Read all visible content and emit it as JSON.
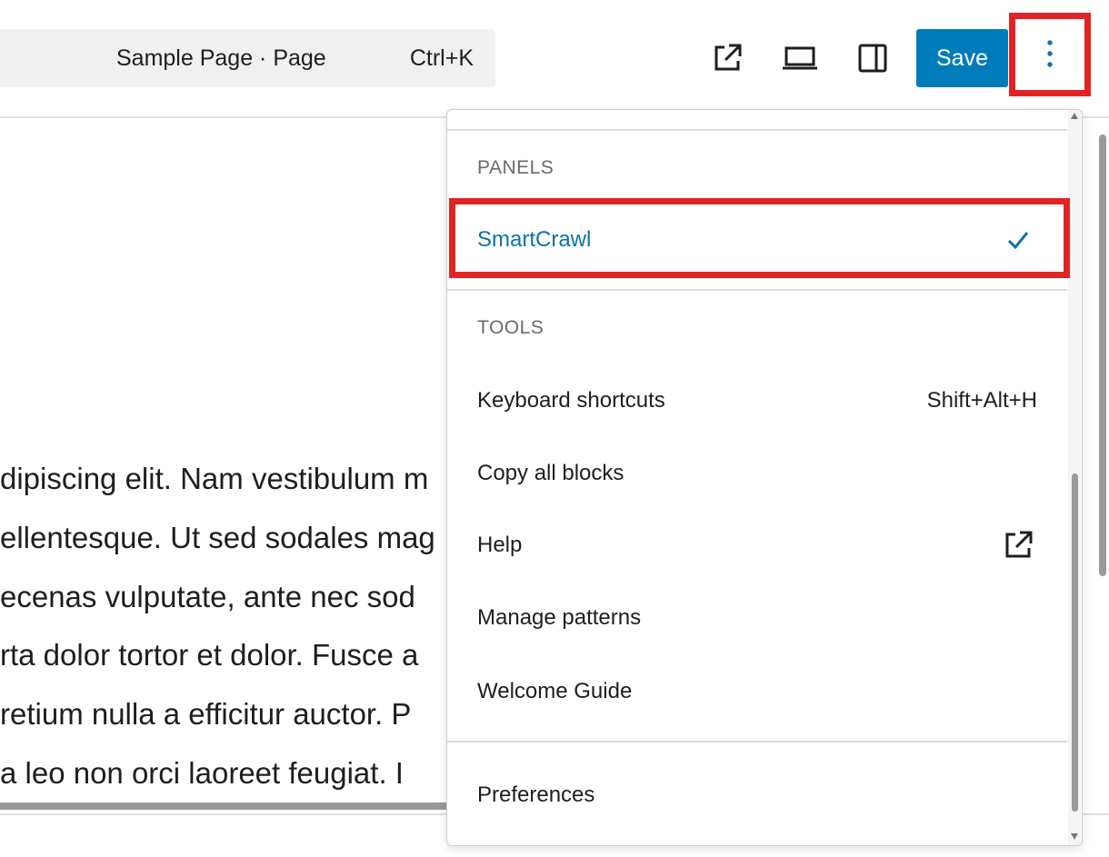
{
  "header": {
    "command_bar": {
      "title": "Sample Page · Page",
      "shortcut": "Ctrl+K"
    },
    "tools": {
      "view_icon": "external-link-icon",
      "device_icon": "laptop-icon",
      "sidebar_icon": "sidebar-toggle-icon",
      "options_icon": "vertical-ellipsis-icon"
    },
    "save_label": "Save",
    "accent_color": "#007cba"
  },
  "content": {
    "lines": [
      "dipiscing elit. Nam vestibulum m",
      "ellentesque. Ut sed sodales mag",
      "ecenas vulputate, ante nec sod",
      "rta dolor tortor et dolor. Fusce a",
      "retium nulla a efficitur auctor. P",
      " a leo non orci laoreet feugiat. I"
    ]
  },
  "menu": {
    "panels_label": "PANELS",
    "panels_items": [
      {
        "label": "SmartCrawl",
        "checked": true,
        "icon": "check-icon"
      }
    ],
    "tools_label": "TOOLS",
    "tools_items": [
      {
        "label": "Keyboard shortcuts",
        "shortcut": "Shift+Alt+H"
      },
      {
        "label": "Copy all blocks"
      },
      {
        "label": "Help",
        "icon": "external-link-icon"
      },
      {
        "label": "Manage patterns"
      },
      {
        "label": "Welcome Guide"
      }
    ],
    "preferences_label": "Preferences"
  },
  "highlight_color": "#e02424"
}
